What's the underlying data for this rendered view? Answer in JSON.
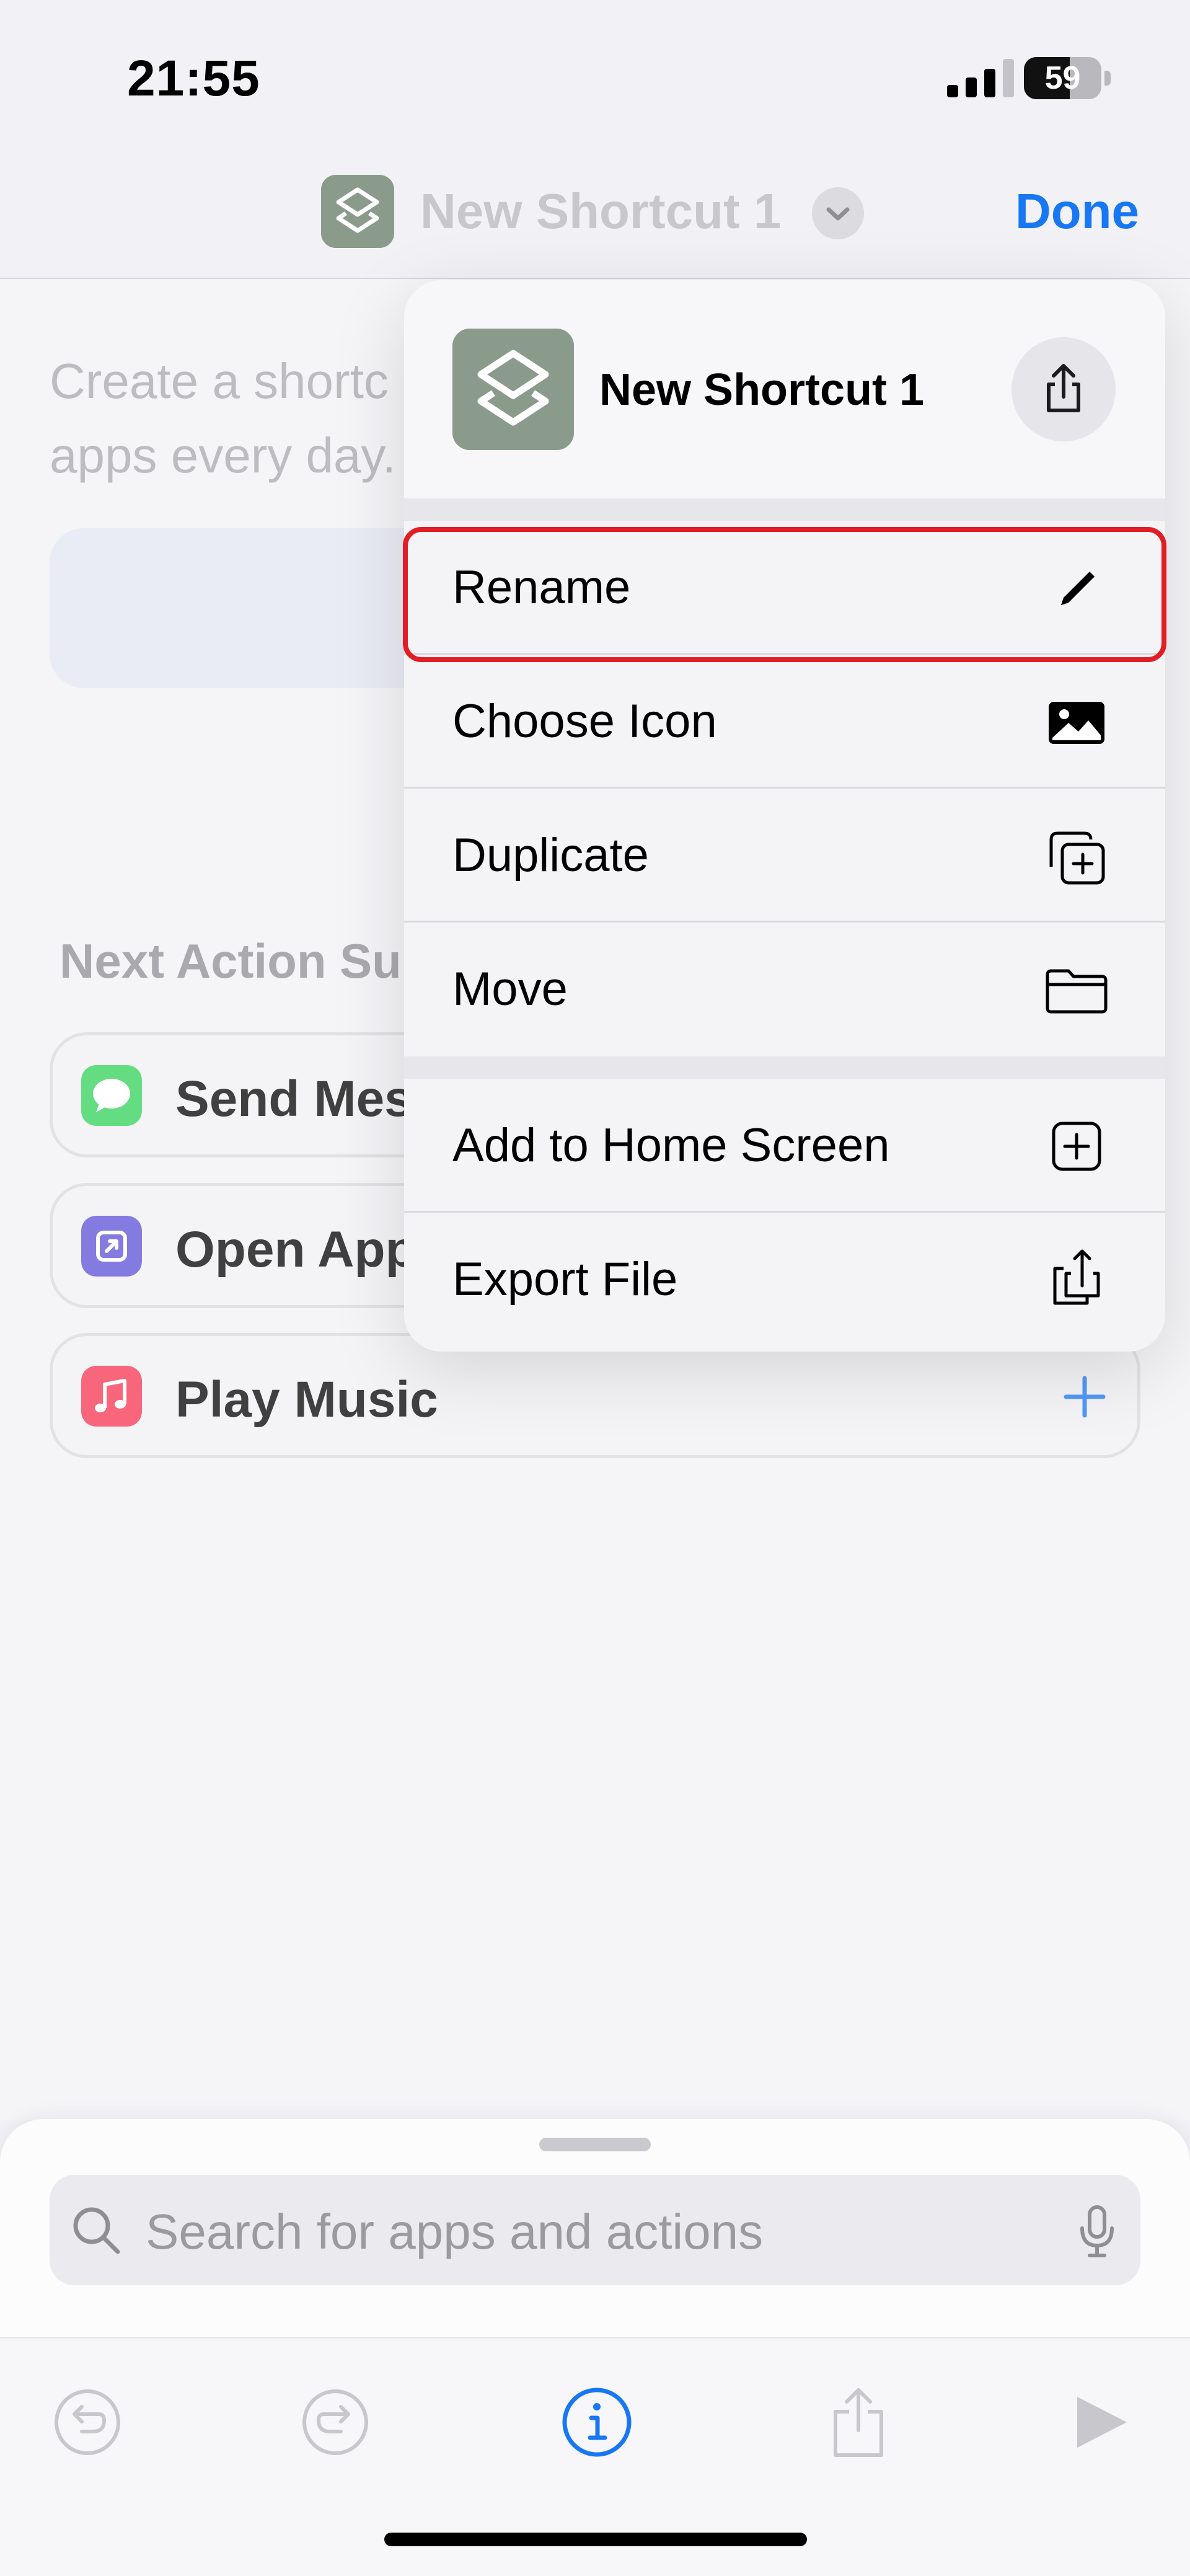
{
  "status_bar": {
    "time": "21:55",
    "battery_percent": "59",
    "battery_level": 0.59,
    "signal_bars": 3
  },
  "nav": {
    "title": "New Shortcut 1",
    "done_label": "Done",
    "accent_color": "#1877f2"
  },
  "background": {
    "description_line1": "Create a shortc",
    "description_line2": "apps every day.",
    "next_action_title": "Next Action Su",
    "suggestions": [
      {
        "label": "Send Mes",
        "icon": "messages-icon",
        "color": "#2fd158"
      },
      {
        "label": "Open App",
        "icon": "open-app-icon",
        "color": "#5b4fd6"
      },
      {
        "label": "Play Music",
        "icon": "music-icon",
        "color": "#f5334e"
      }
    ]
  },
  "menu": {
    "title": "New Shortcut 1",
    "items": [
      {
        "label": "Rename",
        "icon": "pencil-icon"
      },
      {
        "label": "Choose Icon",
        "icon": "photo-icon"
      },
      {
        "label": "Duplicate",
        "icon": "duplicate-icon"
      },
      {
        "label": "Move",
        "icon": "folder-icon"
      },
      {
        "label": "Add to Home Screen",
        "icon": "add-square-icon"
      },
      {
        "label": "Export File",
        "icon": "export-file-icon"
      }
    ],
    "highlight_color": "#e11d25"
  },
  "sheet": {
    "search_placeholder": "Search for apps and actions",
    "toolbar": [
      "undo-icon",
      "redo-icon",
      "info-icon",
      "share-icon",
      "play-icon"
    ]
  }
}
